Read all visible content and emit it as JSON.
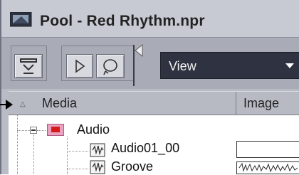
{
  "window": {
    "title": "Pool - Red Rhythm.npr",
    "title_icon": "pool-app-icon"
  },
  "toolbar": {
    "buttons": [
      {
        "icon": "import-icon"
      },
      {
        "icon": "play-icon"
      },
      {
        "icon": "loop-icon"
      }
    ],
    "volume_slider": {
      "icon": "volume-slider-icon"
    },
    "view_select": {
      "label": "View"
    }
  },
  "columns": {
    "media": "Media",
    "image": "Image",
    "sort_indicator": "up-triangle-icon"
  },
  "tree": {
    "root": {
      "label": "Audio",
      "expanded": true,
      "icon": "audio-folder-icon"
    },
    "items": [
      {
        "label": "Audio01_00",
        "icon": "audio-file-icon"
      },
      {
        "label": "Groove",
        "icon": "audio-file-icon"
      }
    ]
  }
}
